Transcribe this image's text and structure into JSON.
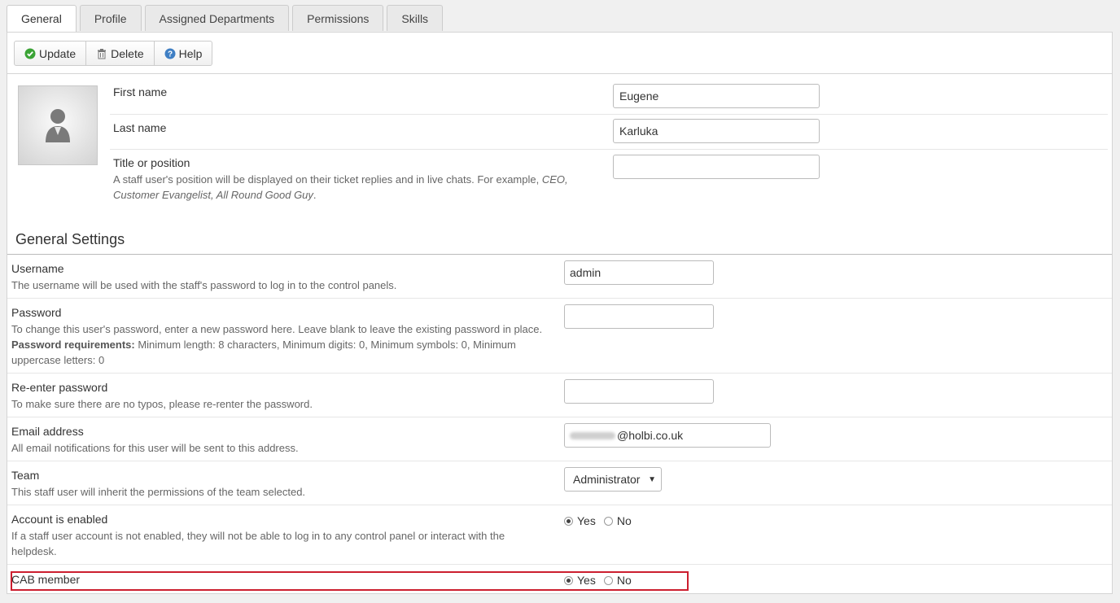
{
  "tabs": [
    "General",
    "Profile",
    "Assigned Departments",
    "Permissions",
    "Skills"
  ],
  "toolbar": {
    "update": "Update",
    "delete": "Delete",
    "help": "Help"
  },
  "profile": {
    "first_name_label": "First name",
    "first_name_value": "Eugene",
    "last_name_label": "Last name",
    "last_name_value": "Karluka",
    "title_label": "Title or position",
    "title_help_prefix": "A staff user's position will be displayed on their ticket replies and in live chats. For example, ",
    "title_help_examples": "CEO, Customer Evangelist, All Round Good Guy",
    "title_help_suffix": ".",
    "title_value": ""
  },
  "general_settings": {
    "title": "General Settings",
    "username_label": "Username",
    "username_help": "The username will be used with the staff's password to log in to the control panels.",
    "username_value": "admin",
    "password_label": "Password",
    "password_help": "To change this user's password, enter a new password here. Leave blank to leave the existing password in place.",
    "password_req_label": "Password requirements:",
    "password_req_text": " Minimum length: 8 characters, Minimum digits: 0, Minimum symbols: 0, Minimum uppercase letters: 0",
    "reenter_label": "Re-enter password",
    "reenter_help": "To make sure there are no typos, please re-renter the password.",
    "email_label": "Email address",
    "email_help": "All email notifications for this user will be sent to this address.",
    "email_domain": "@holbi.co.uk",
    "team_label": "Team",
    "team_help": "This staff user will inherit the permissions of the team selected.",
    "team_value": "Administrator",
    "enabled_label": "Account is enabled",
    "enabled_help": "If a staff user account is not enabled, they will not be able to log in to any control panel or interact with the helpdesk.",
    "cab_label": "CAB member",
    "yes": "Yes",
    "no": "No"
  },
  "colors": {
    "highlight": "#cc1f2f",
    "update_icon": "#3aa335",
    "help_icon": "#3f7fc4"
  }
}
